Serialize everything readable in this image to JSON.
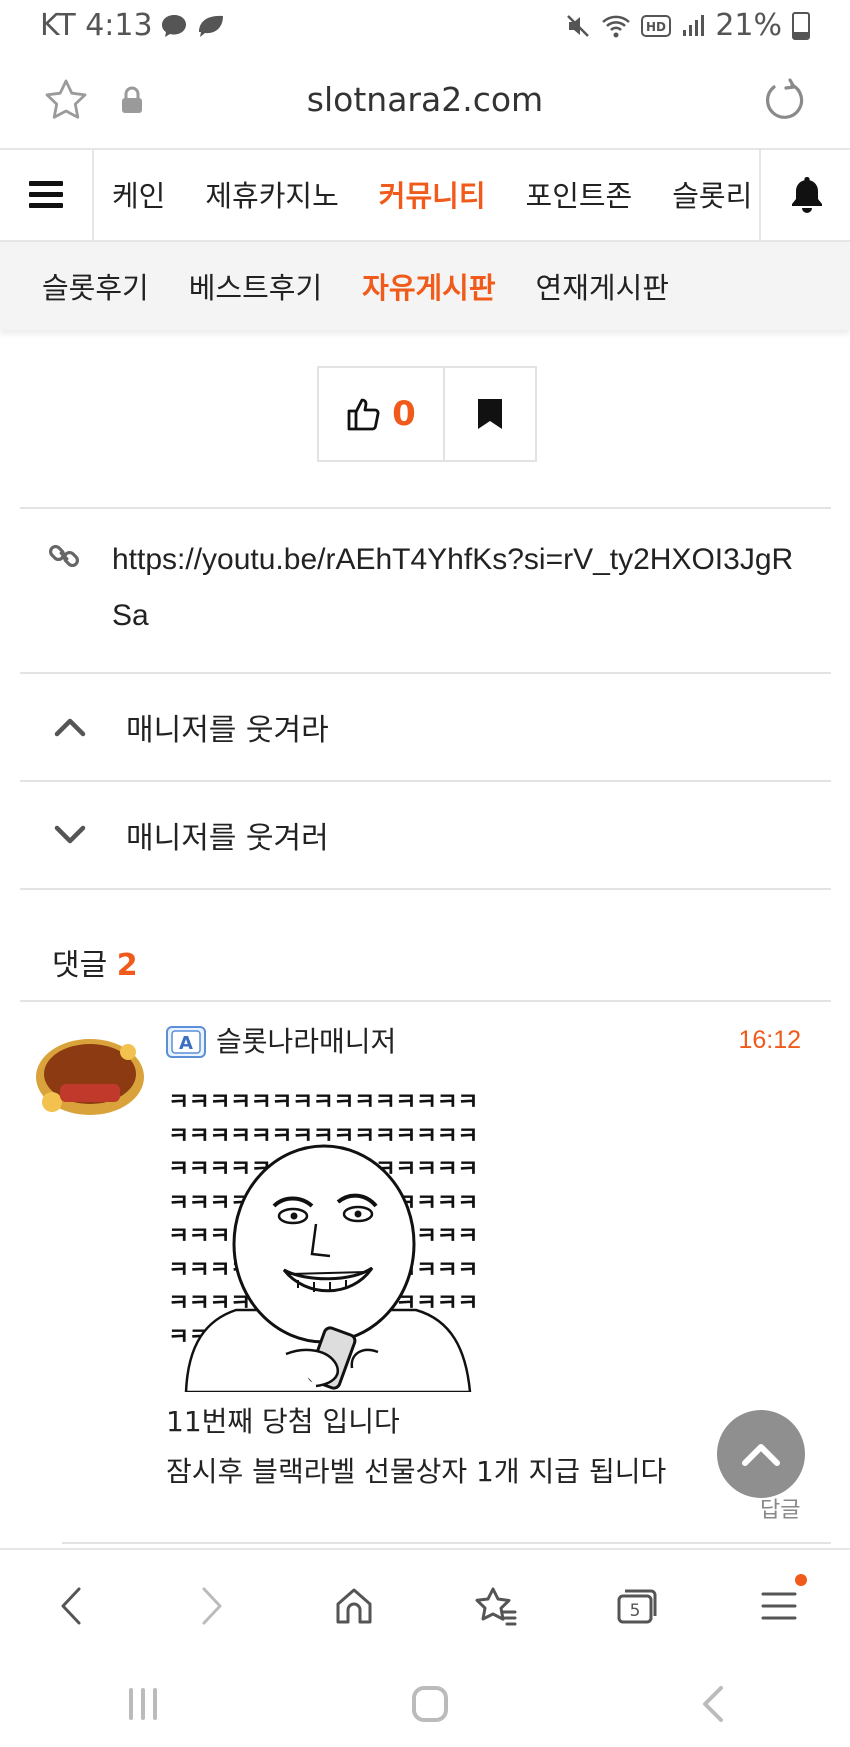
{
  "status_bar": {
    "carrier_time": "KT 4:13",
    "battery": "21%",
    "icons": [
      "chat-bubble-icon",
      "leaf-icon",
      "mute-icon",
      "wifi-icon",
      "hd-icon",
      "signal-icon",
      "battery-icon"
    ]
  },
  "url_bar": {
    "url": "slotnara2.com",
    "icons": [
      "star-icon",
      "lock-icon",
      "reload-icon"
    ]
  },
  "main_nav": {
    "items": [
      {
        "label": "케인",
        "active": false
      },
      {
        "label": "제휴카지노",
        "active": false
      },
      {
        "label": "커뮤니티",
        "active": true
      },
      {
        "label": "포인트존",
        "active": false
      },
      {
        "label": "슬롯리",
        "active": false
      }
    ]
  },
  "sub_nav": {
    "items": [
      {
        "label": "슬롯후기",
        "active": false
      },
      {
        "label": "베스트후기",
        "active": false
      },
      {
        "label": "자유게시판",
        "active": true
      },
      {
        "label": "연재게시판",
        "active": false
      }
    ]
  },
  "post_actions": {
    "like_count": "0"
  },
  "link": {
    "url": "https://youtu.be/rAEhT4YhfKs?si=rV_ty2HXOI3JgRSa"
  },
  "nav_posts": {
    "prev_title": "매니저를 웃겨라",
    "next_title": "매니저를 웃겨러"
  },
  "comments": {
    "label": "댓글",
    "count": "2",
    "items": [
      {
        "author": "슬롯나라매니저",
        "time": "16:12",
        "image_text": "ㅋㅋㅋㅋㅋㅋㅋㅋㅋㅋㅋㅋㅋㅋㅋㅋㅋㅋㅋㅋㅋㅋㅋㅋㅋㅋㅋㅋㅋㅋㅋㅋㅋㅋㅋㅋㅋㅋㅋㅋㅋㅋㅋㅋㅋㅋㅋㅋㅋㅋㅋㅋㅋㅋㅋㅋㅋㅋㅋㅋㅋㅋㅋㅋㅋㅋㅋㅋㅋㅋㅋㅋㅋㅋㅋㅋㅋㅋㅋㅋㅋㅋㅋㅋㅋㅋㅋㅋㅋㅋㅋㅋㅋㅋㅋㅋㅋㅋㅋㅋㅋㅋㅋㅋㅋㅋㅋㅋㅋㅋ",
        "line1": "11번째 당첨 입니다",
        "line2": "잠시후 블랙라벨 선물상자 1개 지급 됩니다"
      }
    ],
    "reply_label": "답글"
  },
  "browser_toolbar": {
    "tabs_count": "5",
    "icons": [
      "back-icon",
      "forward-icon",
      "home-icon",
      "bookmarks-icon",
      "tabs-icon",
      "menu-icon"
    ]
  },
  "colors": {
    "accent": "#f05a1a",
    "divider": "#e3e3e3"
  }
}
